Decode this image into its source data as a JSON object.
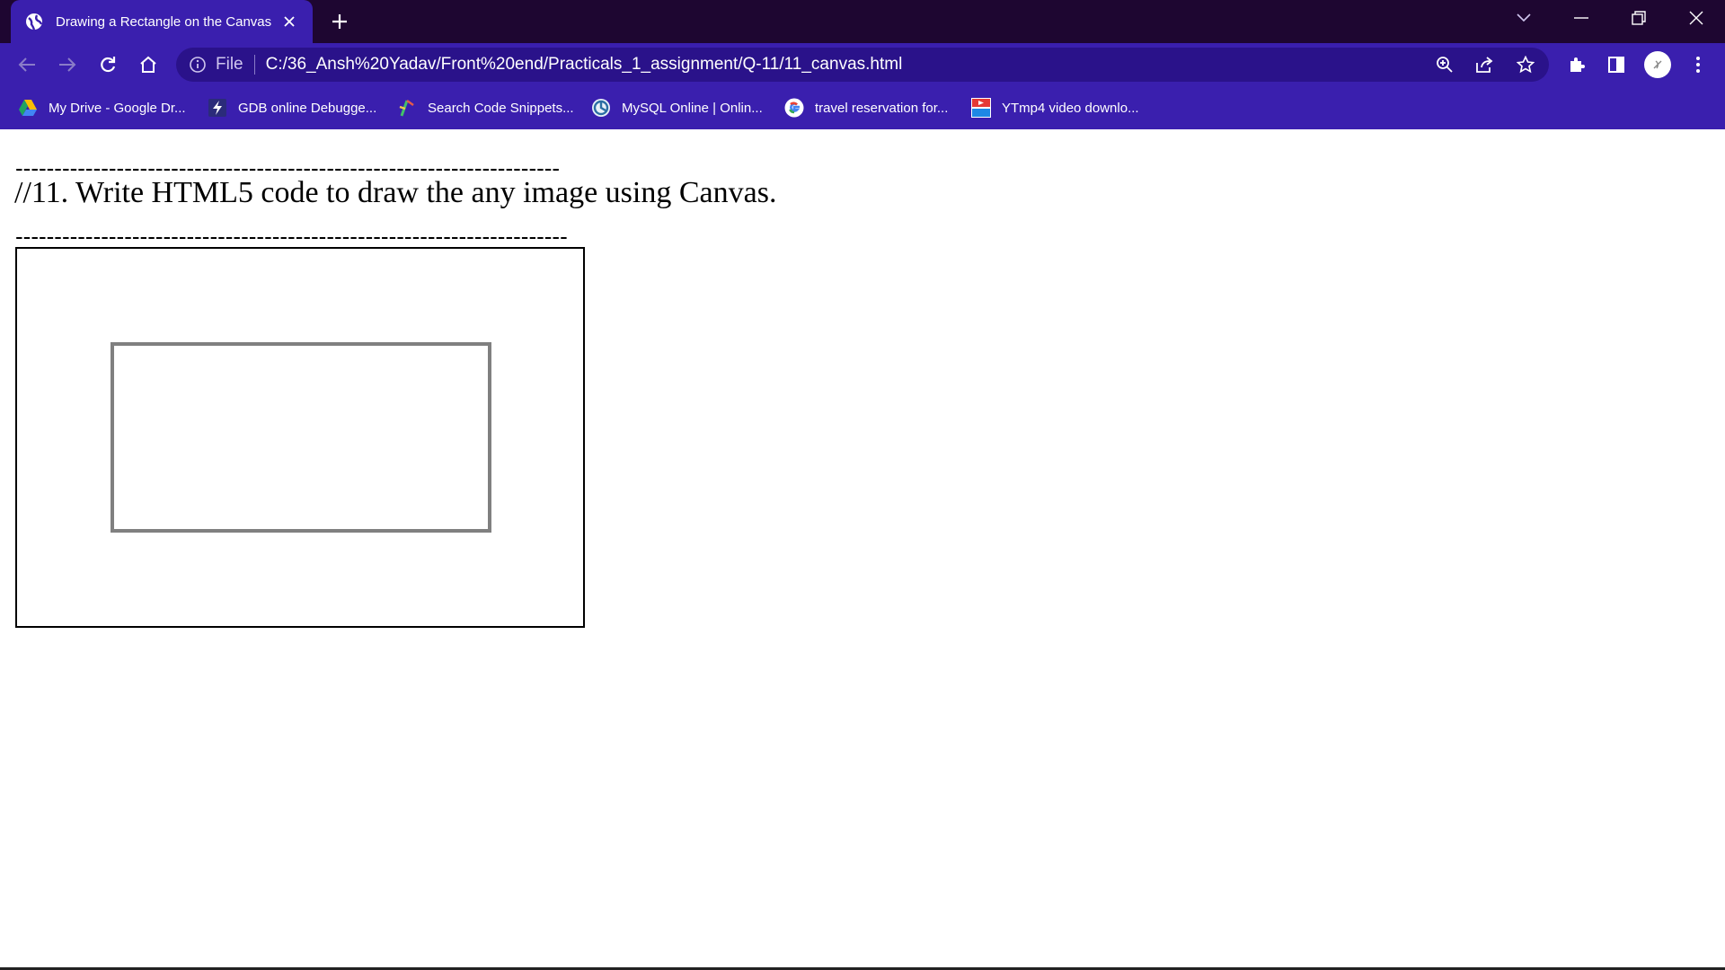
{
  "browser": {
    "tab": {
      "title": "Drawing a Rectangle on the Canvas"
    },
    "omnibox": {
      "scheme_label": "File",
      "url": "C:/36_Ansh%20Yadav/Front%20end/Practicals_1_assignment/Q-11/11_canvas.html"
    },
    "bookmarks": [
      {
        "label": "My Drive - Google Dr...",
        "icon": "google-drive-icon"
      },
      {
        "label": "GDB online Debugge...",
        "icon": "gdb-icon"
      },
      {
        "label": "Search Code Snippets...",
        "icon": "code-snippets-icon"
      },
      {
        "label": "MySQL Online | Onlin...",
        "icon": "mysql-icon"
      },
      {
        "label": "travel reservation for...",
        "icon": "google-icon"
      },
      {
        "label": "YTmp4 video downlo...",
        "icon": "ytmp4-icon"
      }
    ],
    "colors": {
      "tabstrip": "#1e0631",
      "toolbar": "#3a1fae",
      "omnibox": "#2a128a"
    }
  },
  "page": {
    "divider_top": "----------------------------------------------------------------------",
    "heading": "//11. Write HTML5 code to draw the any image using Canvas.",
    "divider_bottom": "-----------------------------------------------------------------------",
    "rect_stroke": "#808080"
  }
}
